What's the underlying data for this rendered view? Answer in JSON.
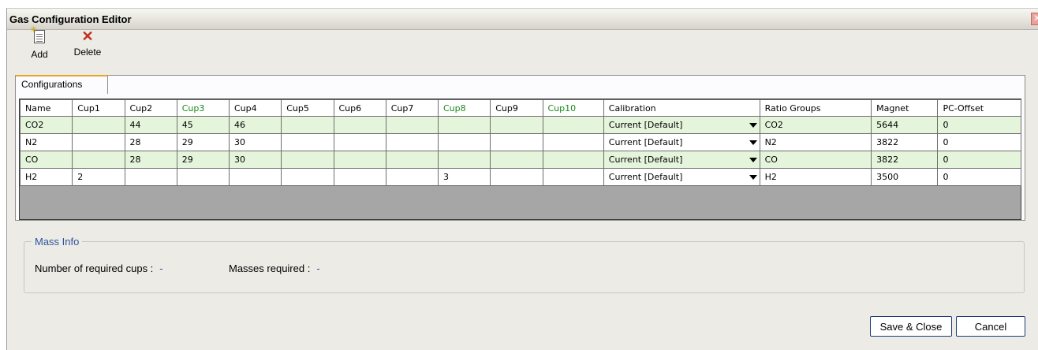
{
  "window": {
    "title": "Gas Configuration Editor"
  },
  "toolbar": {
    "add_label": "Add",
    "delete_label": "Delete"
  },
  "tabs": [
    {
      "label": "Configurations"
    }
  ],
  "grid": {
    "columns": [
      "Name",
      "Cup1",
      "Cup2",
      "Cup3",
      "Cup4",
      "Cup5",
      "Cup6",
      "Cup7",
      "Cup8",
      "Cup9",
      "Cup10",
      "Calibration",
      "Ratio Groups",
      "Magnet",
      "PC-Offset"
    ],
    "highlighted_columns": [
      "Cup3",
      "Cup8",
      "Cup10"
    ],
    "highlight_color": "#1a8a1a",
    "alt_row_color": "#e5f5dc",
    "rows": [
      [
        "CO2",
        "",
        "44",
        "45",
        "46",
        "",
        "",
        "",
        "",
        "",
        "",
        "Current [Default]",
        "CO2",
        "5644",
        "0"
      ],
      [
        "N2",
        "",
        "28",
        "29",
        "30",
        "",
        "",
        "",
        "",
        "",
        "",
        "Current [Default]",
        "N2",
        "3822",
        "0"
      ],
      [
        "CO",
        "",
        "28",
        "29",
        "30",
        "",
        "",
        "",
        "",
        "",
        "",
        "Current [Default]",
        "CO",
        "3822",
        "0"
      ],
      [
        "H2",
        "2",
        "",
        "",
        "",
        "",
        "",
        "",
        "3",
        "",
        "",
        "Current [Default]",
        "H2",
        "3500",
        "0"
      ]
    ]
  },
  "mass_info": {
    "title": "Mass Info",
    "required_cups_label": "Number of required cups :",
    "required_cups_value": "-",
    "masses_required_label": "Masses required :",
    "masses_required_value": "-"
  },
  "buttons": {
    "save_close": "Save & Close",
    "cancel": "Cancel"
  }
}
